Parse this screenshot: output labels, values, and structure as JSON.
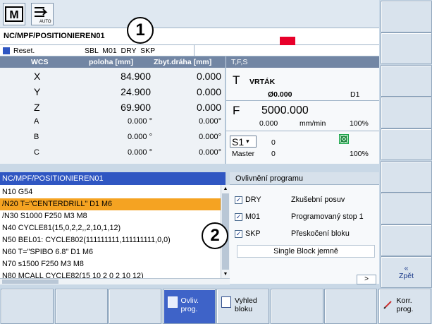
{
  "top": {
    "mode_icon_label": "AUTO",
    "program_path": "NC/MPF/POSITIONIEREN01",
    "status_reset": "Reset.",
    "status_flags": "SBL  M01  DRY  SKP"
  },
  "callouts": [
    "1",
    "2"
  ],
  "axes": {
    "header": {
      "wcs": "WCS",
      "position": "poloha [mm]",
      "distance": "Zbyt.dráha [mm]"
    },
    "rows": [
      {
        "axis": "X",
        "pos": "84.900",
        "dist": "0.000"
      },
      {
        "axis": "Y",
        "pos": "24.900",
        "dist": "0.000"
      },
      {
        "axis": "Z",
        "pos": "69.900",
        "dist": "0.000"
      },
      {
        "axis": "A",
        "pos": "0.000 °",
        "dist": "0.000°"
      },
      {
        "axis": "B",
        "pos": "0.000 °",
        "dist": "0.000°"
      },
      {
        "axis": "C",
        "pos": "0.000 °",
        "dist": "0.000°"
      }
    ]
  },
  "tfs": {
    "header": "T,F,S",
    "t_label": "T",
    "tool_name": "VRTÁK",
    "tool_diameter": "Ø0.000",
    "tool_d": "D1",
    "f_label": "F",
    "feed": "5000.000",
    "feed_actual": "0.000",
    "feed_unit": "mm/min",
    "feed_override": "100%",
    "spindle": "S1",
    "spindle_speed": "0",
    "spindle_master_label": "Master",
    "spindle_master_value": "0",
    "spindle_override": "100%"
  },
  "program": {
    "header": "NC/MPF/POSITIONIEREN01",
    "lines": [
      "N10 G54",
      "/N20 T=\"CENTERDRILL\" D1 M6",
      "/N30 S1000 F250 M3 M8",
      "N40 CYCLE81(15,0,2,2,,2,10,1,12)",
      "N50 BEL01: CYCLE802(111111111,111111111,0,0)",
      "N60 T=\"SPIBO 6.8\" D1 M6",
      "N70 s1500 F250 M3 M8",
      "N80 MCALL CYCLE82(15 10 2 0 2 10 12)"
    ]
  },
  "influence": {
    "header": "Ovlivnění programu",
    "options": [
      {
        "code": "DRY",
        "label": "Zkušební posuv",
        "checked": true
      },
      {
        "code": "M01",
        "label": "Programovaný stop 1",
        "checked": true
      },
      {
        "code": "SKP",
        "label": "Přeskočení bloku",
        "checked": true
      }
    ],
    "single_block": "Single Block jemně",
    "more": ">"
  },
  "right_softkeys": [
    "",
    "",
    "",
    "",
    "",
    "",
    "",
    "",
    "«\nZpět"
  ],
  "bottom_softkeys": [
    {
      "label": "",
      "active": false
    },
    {
      "label": "",
      "active": false
    },
    {
      "label": "",
      "active": false
    },
    {
      "label": "Ovliv.\nprog.",
      "active": true
    },
    {
      "label": "Vyhled\nbloku",
      "active": false
    },
    {
      "label": "",
      "active": false
    },
    {
      "label": "",
      "active": false
    },
    {
      "label": "Korr.\nprog.",
      "active": false
    }
  ],
  "colors": {
    "accent": "#2f56c2",
    "selected_line": "#f5a322",
    "alarm": "#e8002a",
    "panel_header": "#7286a4"
  }
}
